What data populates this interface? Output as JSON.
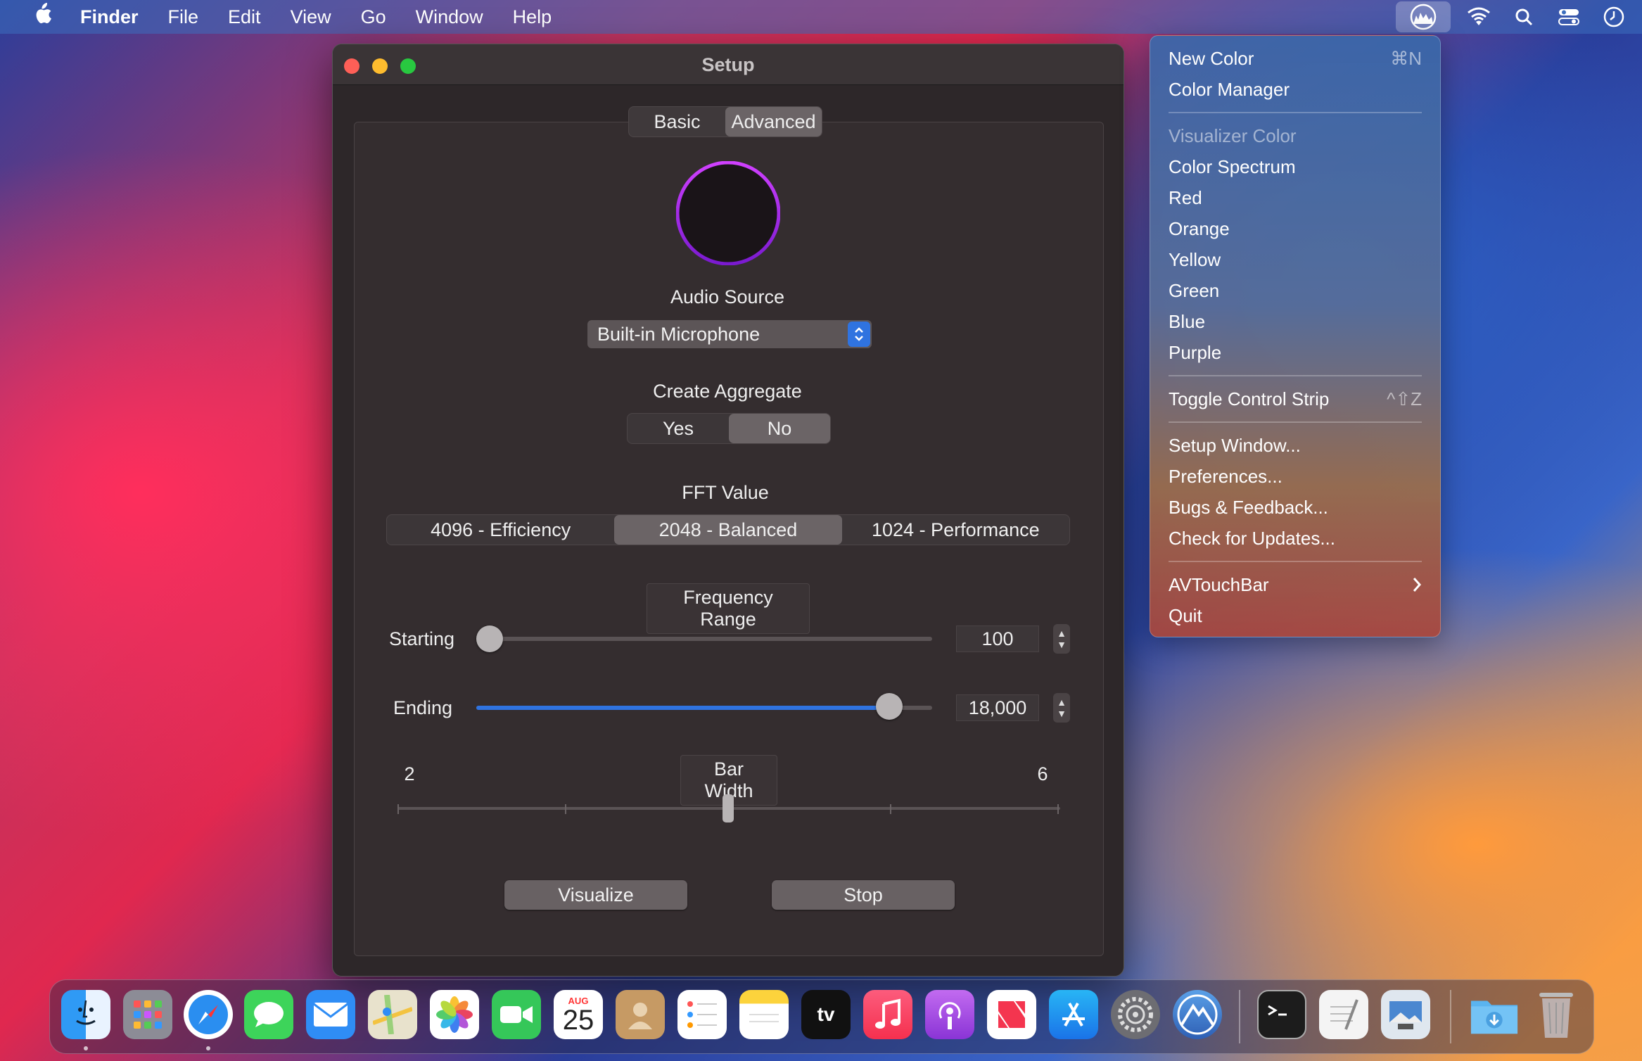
{
  "menubar": {
    "app": "Finder",
    "items": [
      "File",
      "Edit",
      "View",
      "Go",
      "Window",
      "Help"
    ]
  },
  "window": {
    "title": "Setup",
    "tabs": [
      {
        "label": "Basic",
        "selected": false
      },
      {
        "label": "Advanced",
        "selected": true
      }
    ],
    "audio_source_label": "Audio Source",
    "audio_source_value": "Built-in Microphone",
    "create_aggregate_label": "Create Aggregate",
    "aggregate_options": [
      {
        "label": "Yes",
        "selected": false
      },
      {
        "label": "No",
        "selected": true
      }
    ],
    "fft_label": "FFT Value",
    "fft_options": [
      {
        "label": "4096 - Efficiency",
        "selected": false
      },
      {
        "label": "2048 - Balanced",
        "selected": true
      },
      {
        "label": "1024 - Performance",
        "selected": false
      }
    ],
    "frequency_range_label": "Frequency Range",
    "starting_label": "Starting",
    "starting_value": "100",
    "ending_label": "Ending",
    "ending_value": "18,000",
    "bar_width_label": "Bar Width",
    "bar_width_min": "2",
    "bar_width_max": "6",
    "visualize_label": "Visualize",
    "stop_label": "Stop"
  },
  "menu": {
    "new_color": "New Color",
    "new_color_shortcut": "⌘N",
    "color_manager": "Color Manager",
    "visualizer_color": "Visualizer Color",
    "color_spectrum": "Color Spectrum",
    "red": "Red",
    "orange": "Orange",
    "yellow": "Yellow",
    "green": "Green",
    "blue": "Blue",
    "purple": "Purple",
    "toggle_control_strip": "Toggle Control Strip",
    "toggle_shortcut": "^⇧Z",
    "setup_window": "Setup Window...",
    "preferences": "Preferences...",
    "bugs_feedback": "Bugs & Feedback...",
    "check_updates": "Check for Updates...",
    "avtouchbar": "AVTouchBar",
    "quit": "Quit"
  },
  "dock": {
    "calendar_month": "AUG",
    "calendar_day": "25",
    "tv_label": "tv"
  },
  "colors": {
    "accent": "#2f73e0",
    "purple": "#a020f0"
  }
}
